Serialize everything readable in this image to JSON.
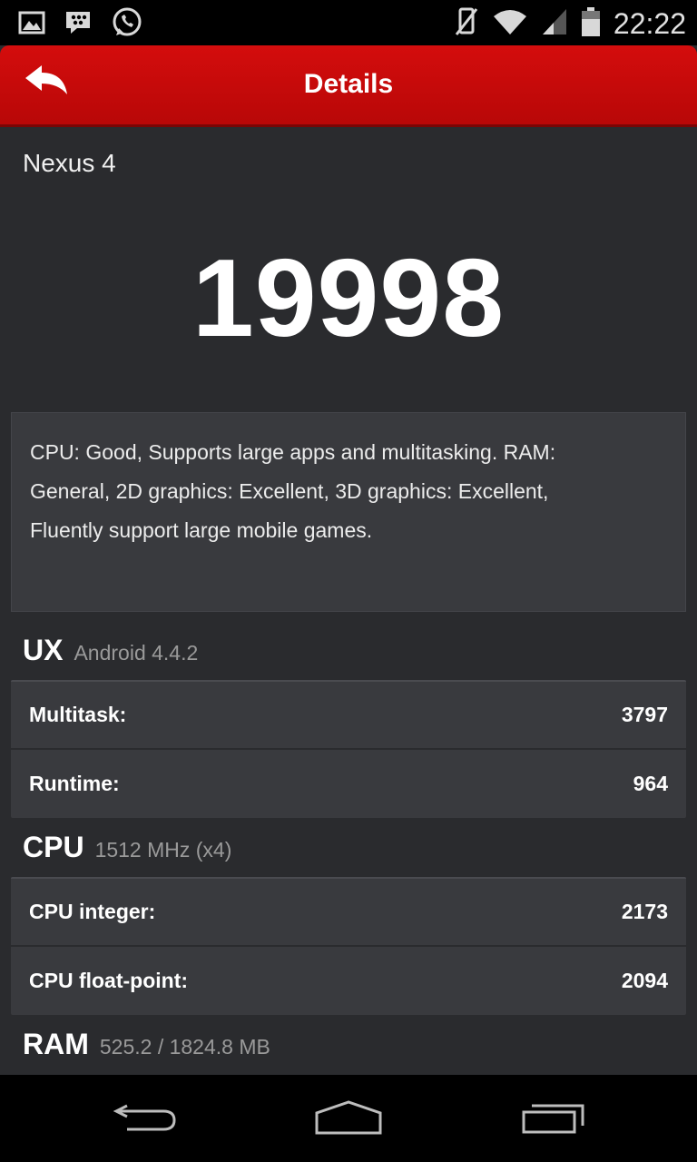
{
  "status_bar": {
    "time": "22:22",
    "left_icons": [
      "image-icon",
      "bbm-icon",
      "whatsapp-icon"
    ],
    "right_icons": [
      "mute-icon",
      "wifi-icon",
      "signal-icon",
      "battery-icon"
    ]
  },
  "action_bar": {
    "title": "Details",
    "back_icon": "back-arrow-icon",
    "color": "#c80a0a"
  },
  "device": {
    "name": "Nexus 4",
    "score": "19998"
  },
  "summary": {
    "text": "CPU: Good, Supports large apps and multitasking. RAM: General, 2D graphics: Excellent, 3D graphics: Excellent, Fluently support large mobile games."
  },
  "sections": {
    "ux": {
      "title": "UX",
      "subtitle": "Android 4.4.2",
      "rows": [
        {
          "label": "Multitask:",
          "value": "3797"
        },
        {
          "label": "Runtime:",
          "value": "964"
        }
      ]
    },
    "cpu": {
      "title": "CPU",
      "subtitle": "1512 MHz (x4)",
      "rows": [
        {
          "label": "CPU integer:",
          "value": "2173"
        },
        {
          "label": "CPU float-point:",
          "value": "2094"
        }
      ]
    },
    "ram": {
      "title": "RAM",
      "subtitle": "525.2 / 1824.8 MB"
    }
  },
  "nav_bar": {
    "buttons": [
      "back-nav-icon",
      "home-nav-icon",
      "recents-nav-icon"
    ]
  }
}
